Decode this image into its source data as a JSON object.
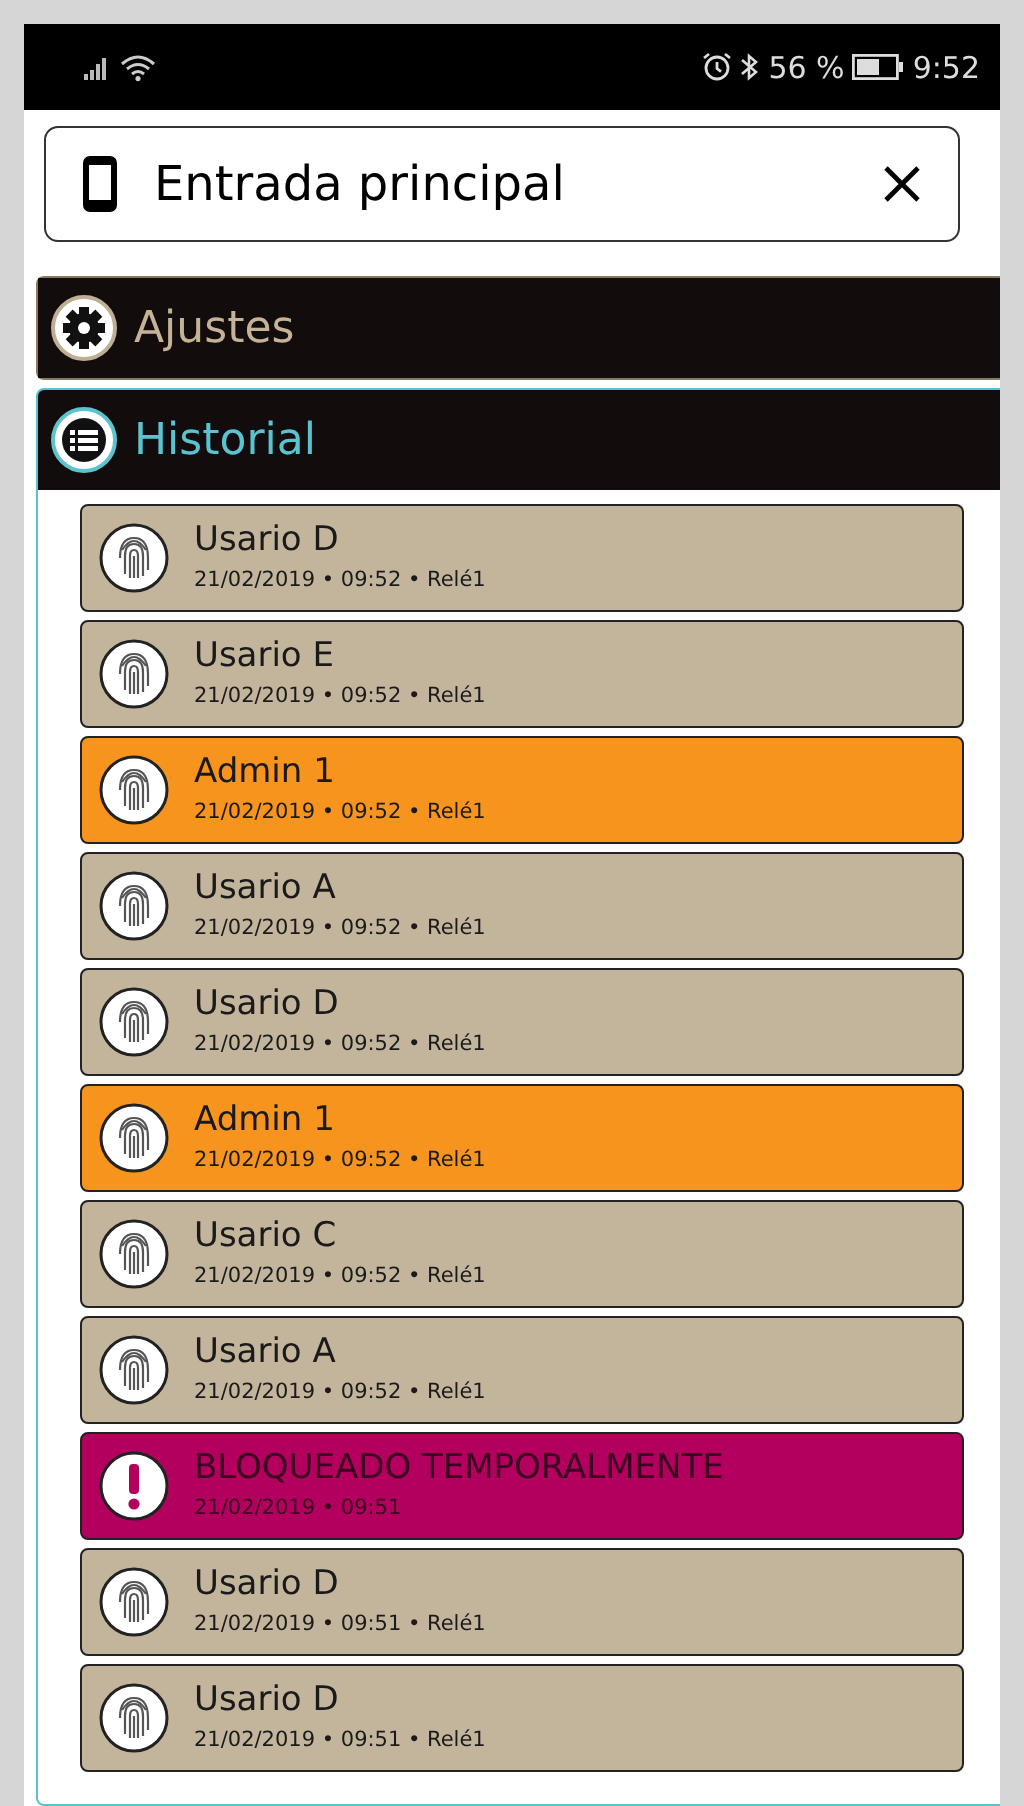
{
  "status_bar": {
    "battery_percent": "56 %",
    "time": "9:52"
  },
  "header": {
    "title": "Entrada principal"
  },
  "sections": [
    {
      "title": "Ajustes",
      "kind": "settings",
      "expanded": false
    },
    {
      "title": "Historial",
      "kind": "history",
      "expanded": true
    }
  ],
  "history": [
    {
      "kind": "user",
      "name": "Usario D",
      "detail": "21/02/2019 • 09:52 • Relé1"
    },
    {
      "kind": "user",
      "name": "Usario E",
      "detail": "21/02/2019 • 09:52 • Relé1"
    },
    {
      "kind": "admin",
      "name": "Admin 1",
      "detail": "21/02/2019 • 09:52 • Relé1"
    },
    {
      "kind": "user",
      "name": "Usario A",
      "detail": "21/02/2019 • 09:52 • Relé1"
    },
    {
      "kind": "user",
      "name": "Usario D",
      "detail": "21/02/2019 • 09:52 • Relé1"
    },
    {
      "kind": "admin",
      "name": "Admin 1",
      "detail": "21/02/2019 • 09:52 • Relé1"
    },
    {
      "kind": "user",
      "name": "Usario C",
      "detail": "21/02/2019 • 09:52 • Relé1"
    },
    {
      "kind": "user",
      "name": "Usario A",
      "detail": "21/02/2019 • 09:52 • Relé1"
    },
    {
      "kind": "alert",
      "name": "BLOQUEADO TEMPORALMENTE",
      "detail": "21/02/2019 • 09:51"
    },
    {
      "kind": "user",
      "name": "Usario D",
      "detail": "21/02/2019 • 09:51 • Relé1"
    },
    {
      "kind": "user",
      "name": "Usario D",
      "detail": "21/02/2019 • 09:51 • Relé1"
    }
  ]
}
